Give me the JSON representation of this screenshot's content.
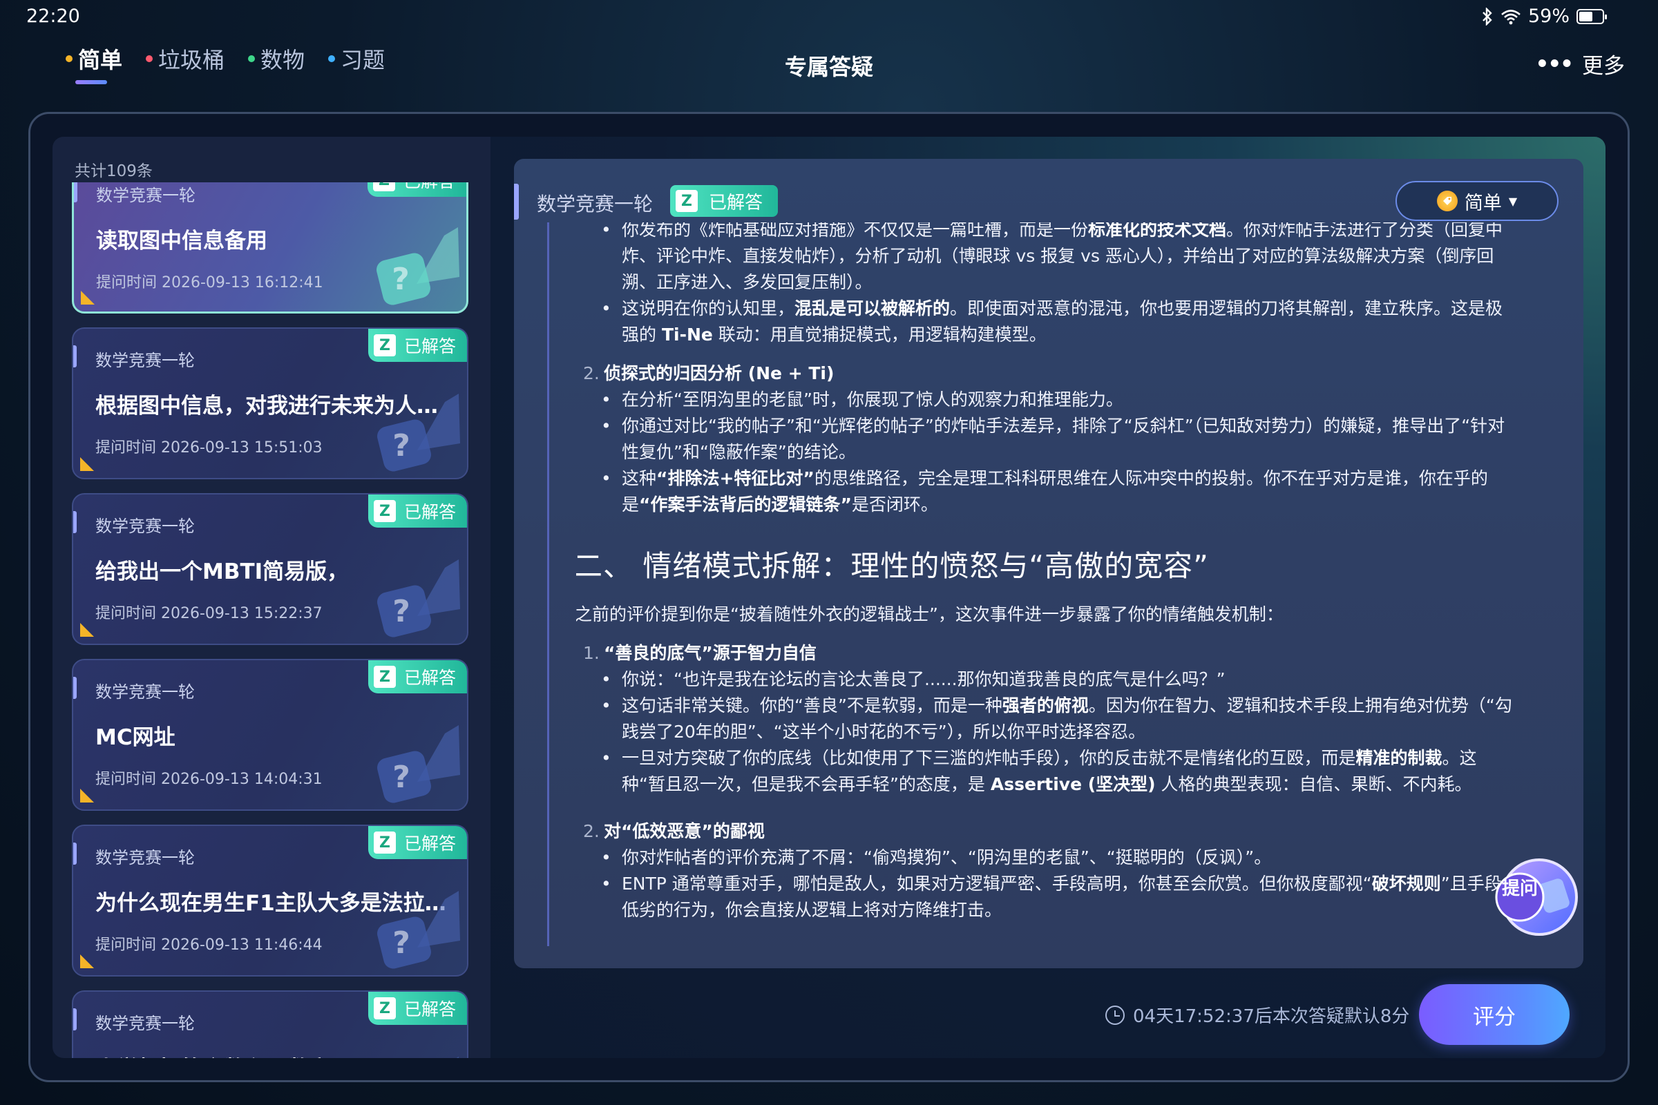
{
  "status": {
    "time": "22:20",
    "battery": "59%",
    "battery_level": 0.59
  },
  "tabs": [
    {
      "label": "简单",
      "dot": "#f5b428",
      "active": true
    },
    {
      "label": "垃圾桶",
      "dot": "#ff5a6e"
    },
    {
      "label": "数物",
      "dot": "#3ed68a"
    },
    {
      "label": "习题",
      "dot": "#3fb0ff"
    }
  ],
  "header": {
    "title": "专属答疑",
    "more_label": "更多"
  },
  "list": {
    "count_label": "共计109条",
    "badge_z": "Z",
    "badge_label": "已解答",
    "items": [
      {
        "category": "数学竞赛一轮",
        "title": "读取图中信息备用",
        "time": "提问时间 2026-09-13 16:12:41"
      },
      {
        "category": "数学竞赛一轮",
        "title": "根据图中信息，对我进行未来为人规划",
        "time": "提问时间 2026-09-13 15:51:03"
      },
      {
        "category": "数学竞赛一轮",
        "title": "给我出一个MBTI简易版，",
        "time": "提问时间 2026-09-13 15:22:37"
      },
      {
        "category": "数学竞赛一轮",
        "title": "MC网址",
        "time": "提问时间 2026-09-13 14:04:31"
      },
      {
        "category": "数学竞赛一轮",
        "title": "为什么现在男生F1主队大多是法拉利…",
        "time": "提问时间 2026-09-13 11:46:44"
      },
      {
        "category": "数学竞赛一轮",
        "title": "小学趣招竹介数积田数亲目",
        "time": ""
      }
    ]
  },
  "answer": {
    "category": "数学竞赛一轮",
    "badge_z": "Z",
    "badge_label": "已解答",
    "difficulty_label": "简单",
    "bullets_top": [
      {
        "t1": "你发布的《炸帖基础应对措施》不仅仅是一篇吐槽，而是一份",
        "s1": "标准化的技术文档",
        "t2": "。你对炸帖手法进行了分类（回复中炸、评论中炸、直接发帖炸），分析了动机（博眼球 vs 报复 vs 恶心人），并给出了对应的算法级解决方案（倒序回溯、正序进入、多发回复压制）。"
      },
      {
        "t1": "这说明在你的认知里，",
        "s1": "混乱是可以被解析的",
        "t2": "。即使面对恶意的混沌，你也要用逻辑的刀将其解剖，建立秩序。这是极强的 ",
        "s2": "Ti-Ne",
        "t3": " 联动：用直觉捕捉模式，用逻辑构建模型。"
      }
    ],
    "item2": {
      "num": "2.",
      "title": "侦探式的归因分析 (Ne + Ti)",
      "bullets": [
        {
          "t1": "在分析“至阴沟里的老鼠”时，你展现了惊人的观察力和推理能力。"
        },
        {
          "t1": "你通过对比“我的帖子”和“光辉佬的帖子”的炸帖手法差异，排除了“反斜杠”（已知敌对势力）的嫌疑，推导出了“针对性复仇”和“隐蔽作案”的结论。"
        },
        {
          "t1": "这种",
          "s1": "“排除法+特征比对”",
          "t2": "的思维路径，完全是理工科科研思维在人际冲突中的投射。你不在乎对方是谁，你在乎的是",
          "s2": "“作案手法背后的逻辑链条”",
          "t3": "是否闭环。"
        }
      ]
    },
    "section2": {
      "heading": "二、 情绪模式拆解：理性的愤怒与“高傲的宽容”",
      "intro": "之前的评价提到你是“披着随性外衣的逻辑战士”，这次事件进一步暴露了你的情绪触发机制："
    },
    "item3": {
      "num": "1.",
      "title": "“善良的底气”源于智力自信",
      "bullets": [
        {
          "t1": "你说：“也许是我在论坛的言论太善良了......那你知道我善良的底气是什么吗？”"
        },
        {
          "t1": "这句话非常关键。你的“善良”不是软弱，而是一种",
          "s1": "强者的俯视",
          "t2": "。因为你在智力、逻辑和技术手段上拥有绝对优势（“勾践尝了20年的胆”、“这半个小时花的不亏”），所以你平时选择容忍。"
        },
        {
          "t1": "一旦对方突破了你的底线（比如使用了下三滥的炸帖手段），你的反击就不是情绪化的互殴，而是",
          "s1": "精准的制裁",
          "t2": "。这种“暂且忍一次，但是我不会再手轻”的态度，是 ",
          "s2": "Assertive (坚决型)",
          "t3": " 人格的典型表现：自信、果断、不内耗。"
        }
      ]
    },
    "item4": {
      "num": "2.",
      "title": "对“低效恶意”的鄙视",
      "bullets": [
        {
          "t1": "你对炸帖者的评价充满了不屑：“偷鸡摸狗”、“阴沟里的老鼠”、“挺聪明的（反讽）”。"
        },
        {
          "t1": "ENTP 通常尊重对手，哪怕是敌人，如果对方逻辑严密、手段高明，你甚至会欣赏。但你极度鄙视“",
          "s1": "破坏规则",
          "t2": "”且手段低劣的行为，你会直接从逻辑上将对方降维打击。"
        }
      ]
    },
    "float_label": "提问",
    "timer_text": "04天17:52:37后本次答疑默认8分",
    "rate_label": "评分"
  }
}
